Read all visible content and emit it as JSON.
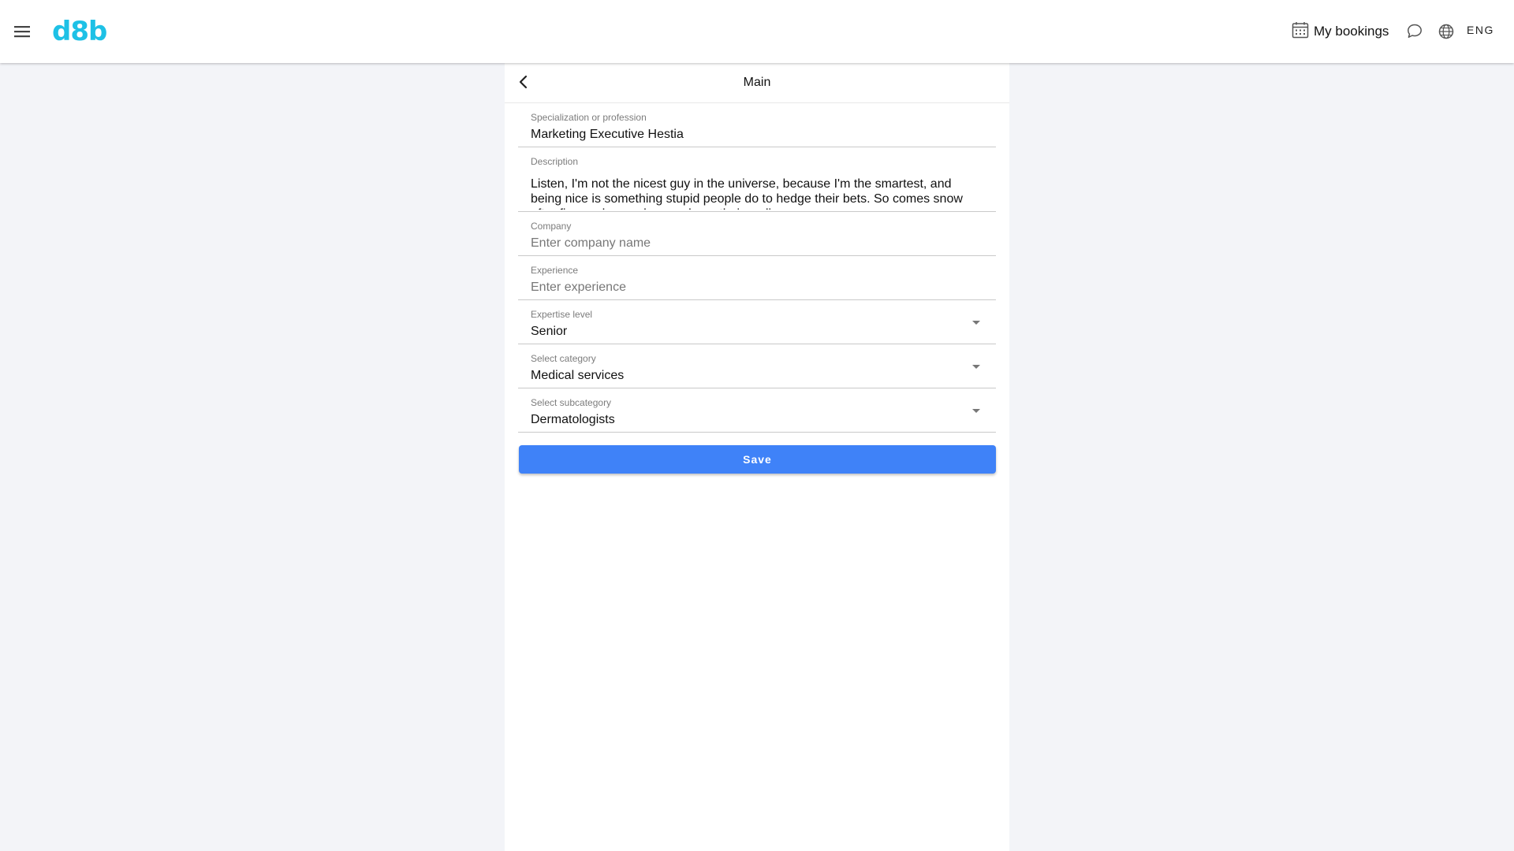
{
  "header": {
    "logo": "d8b",
    "menu_icon": "hamburger-menu-icon",
    "bookings_label": "My bookings",
    "bookings_icon": "calendar-icon",
    "chat_icon": "chat-bubble-icon",
    "language_icon": "globe-icon",
    "language": "ENG",
    "logo_color": "#1ec1e6"
  },
  "panel": {
    "title": "Main",
    "back_icon": "chevron-left-icon"
  },
  "form": {
    "specialization": {
      "label": "Specialization or profession",
      "value": "Marketing Executive Hestia"
    },
    "description": {
      "label": "Description",
      "value": "Listen, I'm not the nicest guy in the universe, because I'm the smartest, and being nice is something stupid people do to hedge their bets. So comes snow after fire, and even dragons have their endings."
    },
    "company": {
      "label": "Company",
      "placeholder": "Enter company name"
    },
    "experience": {
      "label": "Experience",
      "placeholder": "Enter experience"
    },
    "expertise_level": {
      "label": "Expertise level",
      "value": "Senior"
    },
    "category": {
      "label": "Select category",
      "value": "Medical services"
    },
    "subcategory": {
      "label": "Select subcategory",
      "value": "Dermatologists"
    },
    "save_label": "Save",
    "save_color": "#3f82f8"
  }
}
